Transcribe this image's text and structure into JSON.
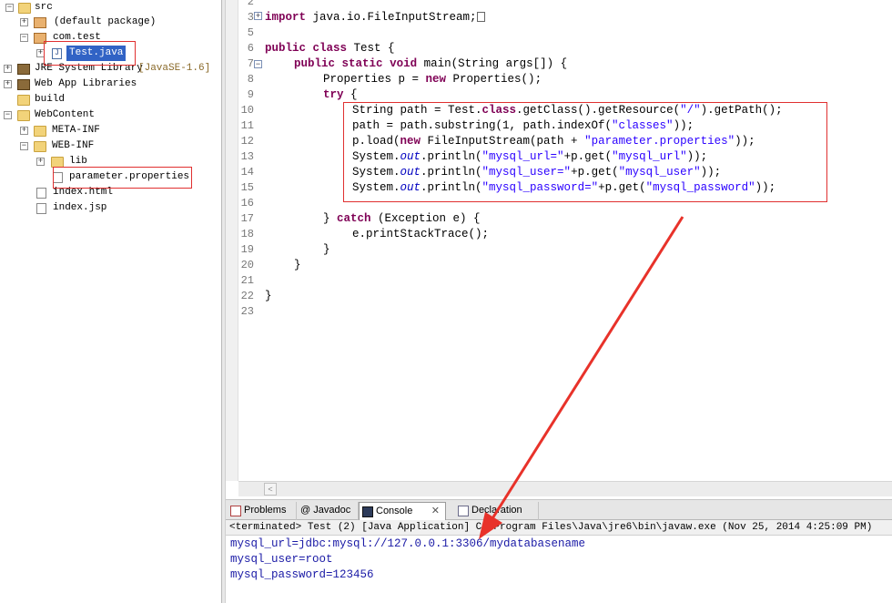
{
  "tree": {
    "items": [
      {
        "label": "src",
        "icon": "folder-icon"
      },
      {
        "label": "(default package)",
        "icon": "package-icon"
      },
      {
        "label": "com.test",
        "icon": "package-icon"
      },
      {
        "label": "Test.java",
        "icon": "java-file-icon"
      },
      {
        "label": "JRE System Library",
        "suffix": "[JavaSE-1.6]",
        "icon": "library-icon"
      },
      {
        "label": "Web App Libraries",
        "icon": "library-icon"
      },
      {
        "label": "build",
        "icon": "folder-icon"
      },
      {
        "label": "WebContent",
        "icon": "folder-icon"
      },
      {
        "label": "META-INF",
        "icon": "folder-icon"
      },
      {
        "label": "WEB-INF",
        "icon": "folder-icon"
      },
      {
        "label": "lib",
        "icon": "folder-icon"
      },
      {
        "label": "parameter.properties",
        "icon": "file-icon"
      },
      {
        "label": "index.html",
        "icon": "file-icon"
      },
      {
        "label": "index.jsp",
        "icon": "file-icon"
      }
    ]
  },
  "editor": {
    "line_numbers": [
      "2",
      "3",
      "5",
      "6",
      "7",
      "8",
      "9",
      "10",
      "11",
      "12",
      "13",
      "14",
      "15",
      "16",
      "17",
      "18",
      "19",
      "20",
      "21",
      "22",
      "23"
    ],
    "lines": {
      "l3_kw": "import",
      "l3_rest": " java.io.FileInputStream;",
      "l6_kw1": "public",
      "l6_kw2": "class",
      "l6_rest": " Test {",
      "l7_kw1": "public",
      "l7_kw2": "static",
      "l7_kw3": "void",
      "l7_rest": " main(String args[]) {",
      "l8_a": "Properties p = ",
      "l8_kw": "new",
      "l8_b": " Properties();",
      "l9_kw": "try",
      "l9_rest": " {",
      "l10_a": "String path = Test.",
      "l10_kw": "class",
      "l10_b": ".getClass().getResource(",
      "l10_s": "\"/\"",
      "l10_c": ").getPath();",
      "l11_a": "path = path.substring(1, path.indexOf(",
      "l11_s": "\"classes\"",
      "l11_b": "));",
      "l12_a": "p.load(",
      "l12_kw": "new",
      "l12_b": " FileInputStream(path + ",
      "l12_s": "\"parameter.properties\"",
      "l12_c": "));",
      "l13_a": "System.",
      "l13_out": "out",
      "l13_b": ".println(",
      "l13_s1": "\"mysql_url=\"",
      "l13_c": "+p.get(",
      "l13_s2": "\"mysql_url\"",
      "l13_d": "));",
      "l14_a": "System.",
      "l14_out": "out",
      "l14_b": ".println(",
      "l14_s1": "\"mysql_user=\"",
      "l14_c": "+p.get(",
      "l14_s2": "\"mysql_user\"",
      "l14_d": "));",
      "l15_a": "System.",
      "l15_out": "out",
      "l15_b": ".println(",
      "l15_s1": "\"mysql_password=\"",
      "l15_c": "+p.get(",
      "l15_s2": "\"mysql_password\"",
      "l15_d": "));",
      "l17_a": "} ",
      "l17_kw": "catch",
      "l17_b": " (Exception e) {",
      "l18": "e.printStackTrace();",
      "l19": "}",
      "l20": "}",
      "l22": "}"
    }
  },
  "tabs": [
    {
      "label": "Problems",
      "icon": "problems-icon"
    },
    {
      "label": "@ Javadoc",
      "icon": "javadoc-icon"
    },
    {
      "label": "Console",
      "icon": "console-icon",
      "active": true
    },
    {
      "label": "Declaration",
      "icon": "declaration-icon"
    }
  ],
  "console": {
    "status": "<terminated> Test (2) [Java Application] C:\\Program Files\\Java\\jre6\\bin\\javaw.exe (Nov 25, 2014 4:25:09 PM)",
    "output": [
      "mysql_url=jdbc:mysql://127.0.0.1:3306/mydatabasename",
      "mysql_user=root",
      "mysql_password=123456"
    ]
  },
  "colors": {
    "keyword": "#7f0055",
    "string": "#2a00ff",
    "annotation_red": "#e03030",
    "console_text": "#1a1aa6"
  }
}
